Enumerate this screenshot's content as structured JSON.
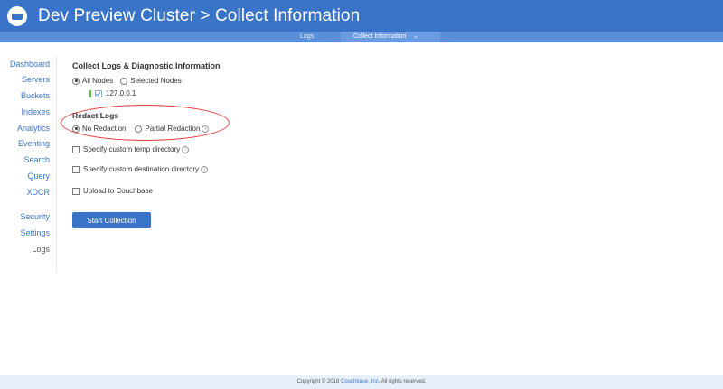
{
  "header": {
    "title": "Dev Preview Cluster > Collect Information"
  },
  "subnav": {
    "logs_tab": "Logs",
    "collect_tab": "Collect Information",
    "collect_chevron": "⌄"
  },
  "sidebar": {
    "items": [
      {
        "label": "Dashboard"
      },
      {
        "label": "Servers"
      },
      {
        "label": "Buckets"
      },
      {
        "label": "Indexes"
      },
      {
        "label": "Analytics"
      },
      {
        "label": "Eventing"
      },
      {
        "label": "Search"
      },
      {
        "label": "Query"
      },
      {
        "label": "XDCR"
      },
      {
        "label": "Security"
      },
      {
        "label": "Settings"
      },
      {
        "label": "Logs"
      }
    ]
  },
  "main": {
    "heading": "Collect Logs & Diagnostic Information",
    "nodes": {
      "all_nodes": "All Nodes",
      "selected_nodes": "Selected Nodes",
      "node_ip": "127.0.0.1",
      "selected": "All Nodes"
    },
    "redact": {
      "title": "Redact Logs",
      "no_redaction": "No Redaction",
      "partial_redaction": "Partial Redaction",
      "selected": "No Redaction"
    },
    "options": {
      "custom_temp": "Specify custom temp directory",
      "custom_dest": "Specify custom destination directory",
      "upload": "Upload to Couchbase"
    },
    "start_button": "Start Collection"
  },
  "footer": {
    "prefix": "Copyright © 2018",
    "company": "Couchbase, Inc.",
    "suffix": "All rights reserved."
  },
  "colors": {
    "header": "#3a74c9",
    "accent": "#3a74c9",
    "highlight_oval": "#e03a3a"
  }
}
